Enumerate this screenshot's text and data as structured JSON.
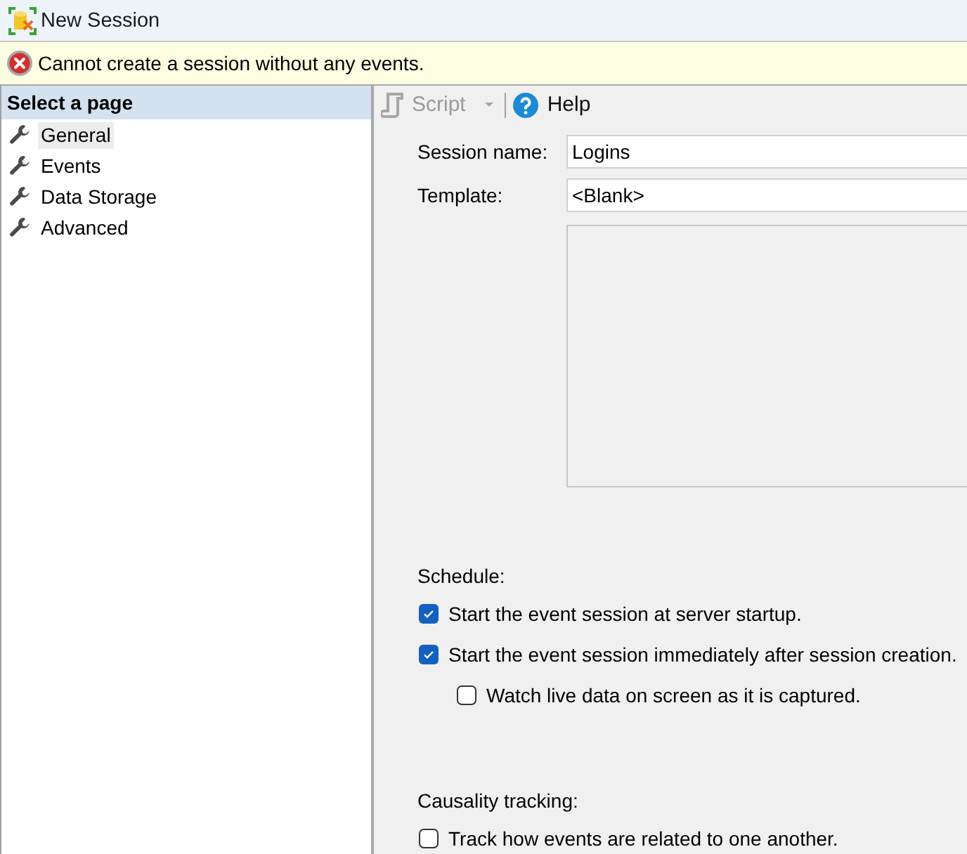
{
  "window": {
    "title": "New Session"
  },
  "error_bar": {
    "message": "Cannot create a session without any events."
  },
  "sidebar": {
    "header": "Select a page",
    "items": [
      {
        "label": "General",
        "selected": true
      },
      {
        "label": "Events",
        "selected": false
      },
      {
        "label": "Data Storage",
        "selected": false
      },
      {
        "label": "Advanced",
        "selected": false
      }
    ]
  },
  "toolbar": {
    "buttons": [
      {
        "kind": "script",
        "label": "Script",
        "disabled": true
      },
      {
        "kind": "help",
        "label": "Help",
        "disabled": false
      }
    ]
  },
  "form": {
    "fields": [
      {
        "label": "Session name:",
        "value": "Logins"
      },
      {
        "label": "Template:",
        "value": "<Blank>"
      }
    ]
  },
  "schedule": {
    "heading": "Schedule:",
    "options": [
      {
        "label": "Start the event session at server startup.",
        "checked": true
      },
      {
        "label": "Start the event session immediately after session creation.",
        "checked": true,
        "children": [
          {
            "label": "Watch live data on screen as it is captured.",
            "checked": false
          }
        ]
      }
    ]
  },
  "causality_tracking": {
    "heading": "Causality tracking:",
    "options": [
      {
        "label": "Track how events are related to one another.",
        "checked": false
      }
    ]
  }
}
